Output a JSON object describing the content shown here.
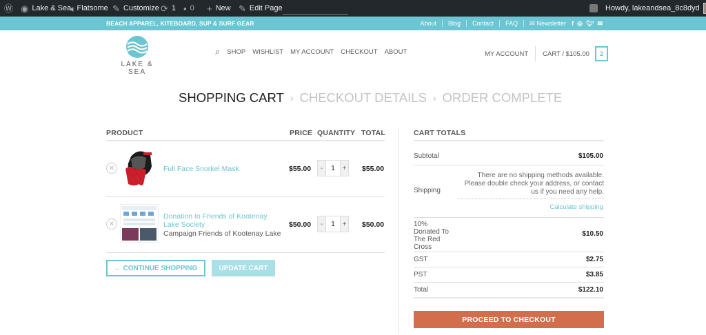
{
  "adminbar": {
    "site_name": "Lake & Sea",
    "theme": "Flatsome",
    "customize": "Customize",
    "updates_count": "1",
    "comments_count": "0",
    "new_label": "New",
    "edit_page": "Edit Page",
    "howdy": "Howdy, lakeandsea_8c8dyd"
  },
  "topbar": {
    "tagline": "BEACH APPAREL, KITEBOARD, SUP & SURF GEAR",
    "links": [
      "About",
      "Blog",
      "Contact",
      "FAQ"
    ],
    "newsletter": "Newsletter"
  },
  "header": {
    "logo_text": "LAKE & SEA",
    "nav": [
      "SHOP",
      "WISHLIST",
      "MY ACCOUNT",
      "CHECKOUT",
      "ABOUT"
    ],
    "my_account": "MY ACCOUNT",
    "cart_label": "CART / $105.00",
    "cart_count": "2"
  },
  "steps": {
    "current": "SHOPPING CART",
    "checkout": "CHECKOUT DETAILS",
    "complete": "ORDER COMPLETE"
  },
  "cart": {
    "headers": {
      "product": "PRODUCT",
      "price": "PRICE",
      "quantity": "QUANTITY",
      "total": "TOTAL"
    },
    "items": [
      {
        "name": "Full Face Snorkel Mask",
        "price": "$55.00",
        "qty": "1",
        "total": "$55.00"
      },
      {
        "name": "Donation to Friends of Kootenay Lake Society",
        "meta": "Campaign Friends of Kootenay Lake",
        "price": "$50.00",
        "qty": "1",
        "total": "$50.00"
      }
    ],
    "continue_label": "← CONTINUE SHOPPING",
    "update_label": "UPDATE CART"
  },
  "totals": {
    "title": "CART TOTALS",
    "subtotal_label": "Subtotal",
    "subtotal": "$105.00",
    "shipping_label": "Shipping",
    "shipping_note": "There are no shipping methods available. Please double check your address, or contact us if you need any help.",
    "calculate": "Calculate shipping",
    "donation_label": "10% Donated To The Red Cross",
    "donation": "$10.50",
    "gst_label": "GST",
    "gst": "$2.75",
    "pst_label": "PST",
    "pst": "$3.85",
    "total_label": "Total",
    "total": "$122.10",
    "checkout_label": "PROCEED TO CHECKOUT"
  },
  "colors": {
    "accent": "#6bc5d2",
    "checkout": "#d26e4b",
    "adminbar": "#23282d"
  }
}
